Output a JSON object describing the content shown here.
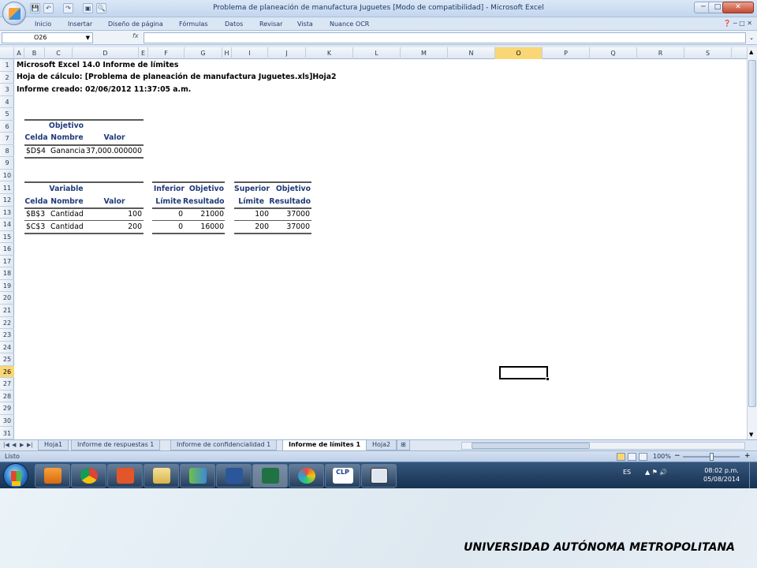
{
  "window": {
    "title": "Problema de planeación de manufactura Juguetes  [Modo de compatibilidad]  -  Microsoft Excel",
    "min": "─",
    "max": "□",
    "close": "✕"
  },
  "quick_access": [
    "💾",
    "↶",
    "↷",
    "▣",
    "🔍"
  ],
  "ribbon": {
    "tabs": [
      "Inicio",
      "Insertar",
      "Diseño de página",
      "Fórmulas",
      "Datos",
      "Revisar",
      "Vista",
      "Nuance OCR"
    ],
    "right_icons": "❓ ─ □ ✕"
  },
  "formula_bar": {
    "name_box": "O26",
    "fx": "fx",
    "content": ""
  },
  "columns": [
    "A",
    "B",
    "C",
    "D",
    "E",
    "F",
    "G",
    "H",
    "I",
    "J",
    "K",
    "L",
    "M",
    "N",
    "O",
    "P",
    "Q",
    "R",
    "S"
  ],
  "selected_column": "O",
  "selected_row": "26",
  "rows": [
    "1",
    "2",
    "3",
    "4",
    "5",
    "6",
    "7",
    "8",
    "9",
    "10",
    "11",
    "12",
    "13",
    "14",
    "15",
    "16",
    "17",
    "18",
    "19",
    "20",
    "21",
    "22",
    "23",
    "24",
    "25",
    "26",
    "27",
    "28",
    "29",
    "30",
    "31"
  ],
  "report": {
    "line1": "Microsoft Excel 14.0 Informe de límites",
    "line2": "Hoja de cálculo: [Problema de planeación de manufactura Juguetes.xls]Hoja2",
    "line3": "Informe creado: 02/06/2012 11:37:05 a.m.",
    "objective": {
      "header1": "Objetivo",
      "h_cell": "Celda",
      "h_name": "Nombre",
      "h_value": "Valor",
      "cell": "$D$4",
      "name": "Ganancia",
      "value": "37,000.000000"
    },
    "variables": {
      "header1": "Variable",
      "h_cell": "Celda",
      "h_name": "Nombre",
      "h_value": "Valor",
      "rows": [
        {
          "cell": "$B$3",
          "name": "Cantidad",
          "value": "100"
        },
        {
          "cell": "$C$3",
          "name": "Cantidad",
          "value": "200"
        }
      ]
    },
    "lower": {
      "h1a": "Inferior",
      "h1b": "Objetivo",
      "h2a": "Límite",
      "h2b": "Resultado",
      "rows": [
        {
          "limit": "0",
          "result": "21000"
        },
        {
          "limit": "0",
          "result": "16000"
        }
      ]
    },
    "upper": {
      "h1a": "Superior",
      "h1b": "Objetivo",
      "h2a": "Límite",
      "h2b": "Resultado",
      "rows": [
        {
          "limit": "100",
          "result": "37000"
        },
        {
          "limit": "200",
          "result": "37000"
        }
      ]
    }
  },
  "sheet_tabs": [
    "Hoja1",
    "Informe de respuestas 1",
    "Informe de confidencialidad 1",
    "Informe de límites 1",
    "Hoja2"
  ],
  "active_tab": "Informe de límites 1",
  "status": {
    "text": "Listo",
    "zoom": "100%",
    "minus": "−",
    "plus": "+"
  },
  "taskbar": {
    "lang": "ES",
    "tray_icons": "▲ ⚑ 🔊",
    "time": "08:02 p.m.",
    "date": "05/08/2014",
    "clp": "CLP"
  },
  "footer": "UNIVERSIDAD AUTÓNOMA METROPOLITANA"
}
